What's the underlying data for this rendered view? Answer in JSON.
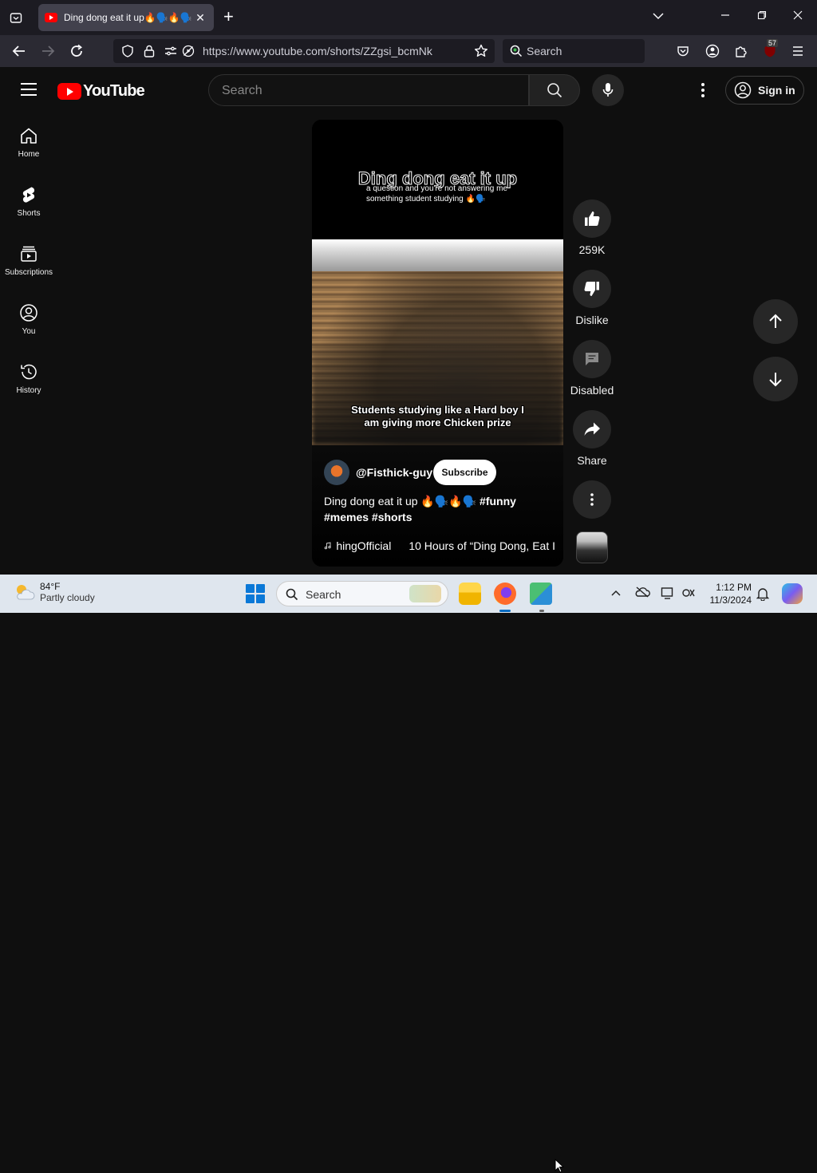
{
  "browser": {
    "tab_title": "Ding dong eat it up🔥🗣️🔥🗣️",
    "tab_close": "✕",
    "new_tab": "+",
    "url": "https://www.youtube.com/shorts/ZZgsi_bcmNk",
    "search_placeholder": "Search",
    "extension_badge": "57"
  },
  "youtube": {
    "logo_text": "YouTube",
    "search_placeholder": "Search",
    "sign_in": "Sign in",
    "sidebar": [
      {
        "label": "Home",
        "icon": "home-icon"
      },
      {
        "label": "Shorts",
        "icon": "shorts-icon"
      },
      {
        "label": "Subscriptions",
        "icon": "subscriptions-icon"
      },
      {
        "label": "You",
        "icon": "you-icon"
      },
      {
        "label": "History",
        "icon": "history-icon"
      }
    ],
    "short": {
      "ghost_title": "Ding dong eat it up",
      "caption": "a question and you're not answering me something student studying 🔥🗣️",
      "overlay_text": "Students studying like a Hard boy I am giving more Chicken prize",
      "channel": "@Fisthick-guy",
      "subscribe": "Subscribe",
      "description": "Ding dong eat it up 🔥🗣️🔥🗣️",
      "hashtags": "#funny #memes #shorts",
      "music_1": "hingOfficial",
      "music_2": "10 Hours of “Ding Dong, Eat I"
    },
    "actions": {
      "likes": "259K",
      "dislike": "Dislike",
      "comments": "Disabled",
      "share": "Share"
    }
  },
  "taskbar": {
    "temperature": "84°F",
    "condition": "Partly cloudy",
    "search": "Search",
    "time": "1:12 PM",
    "date": "11/3/2024"
  }
}
